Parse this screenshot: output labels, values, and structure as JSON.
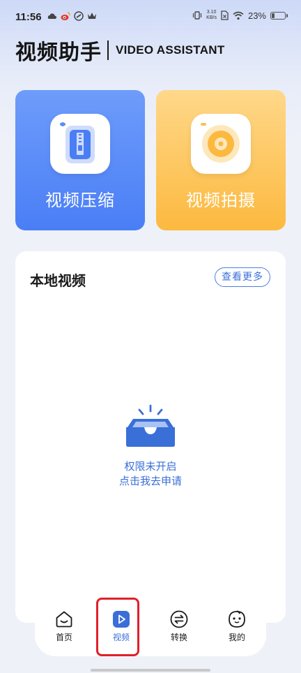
{
  "status_bar": {
    "time": "11:56",
    "net_speed_value": "3.10",
    "net_speed_unit": "KB/s",
    "battery_percent": "23%",
    "battery_level": 0.23
  },
  "header": {
    "title_cn": "视频助手",
    "title_en": "VIDEO ASSISTANT"
  },
  "cards": {
    "compress": {
      "label": "视频压缩",
      "color": "#5486f7"
    },
    "shoot": {
      "label": "视频拍摄",
      "color": "#fcc04e"
    }
  },
  "local_videos": {
    "title": "本地视频",
    "more_label": "查看更多",
    "empty_line1": "权限未开启",
    "empty_line2": "点击我去申请"
  },
  "bottom_nav": {
    "items": [
      {
        "label": "首页",
        "icon": "home-icon",
        "active": false
      },
      {
        "label": "视频",
        "icon": "play-icon",
        "active": true
      },
      {
        "label": "转换",
        "icon": "swap-icon",
        "active": false
      },
      {
        "label": "我的",
        "icon": "profile-face-icon",
        "active": false
      }
    ]
  },
  "colors": {
    "accent": "#3a6fd8",
    "highlight": "#e0202a"
  }
}
